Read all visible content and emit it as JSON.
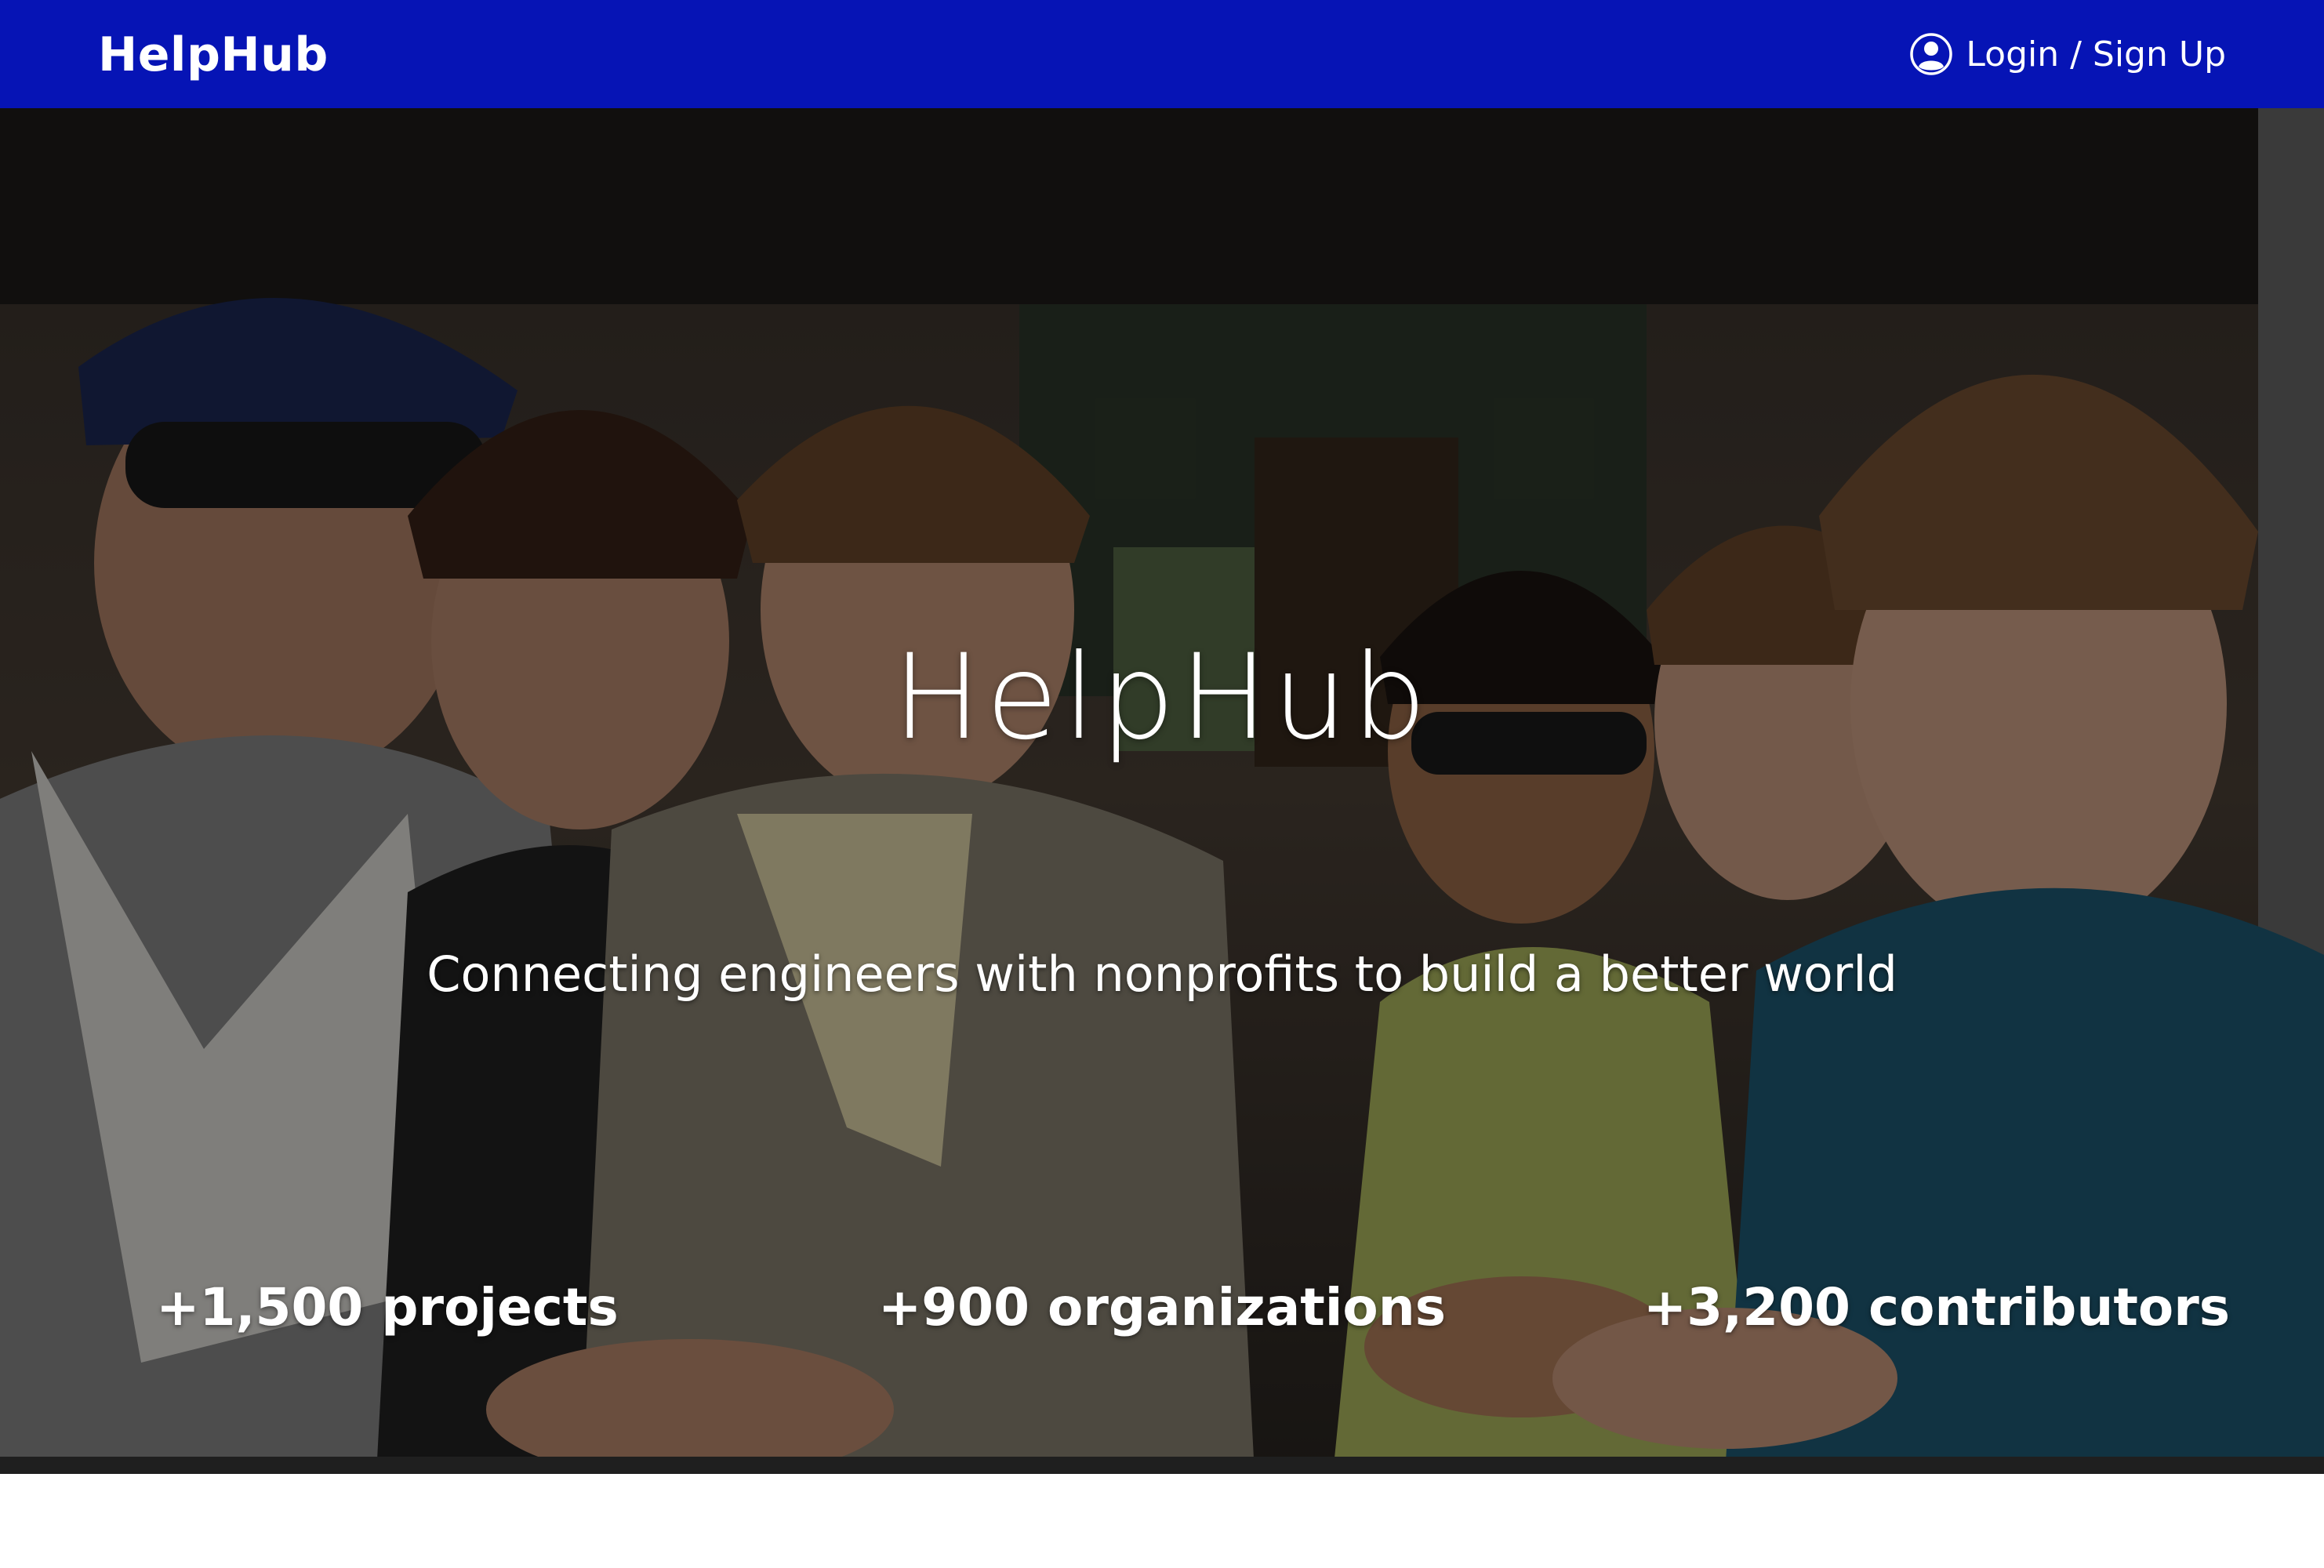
{
  "navbar": {
    "brand": "HelpHub",
    "login_label": "Login / Sign Up",
    "login_icon": "user-circle-icon",
    "background_color": "#0614b5"
  },
  "hero": {
    "title": "HelpHub",
    "subtitle": "Connecting engineers with nonprofits to build a better world",
    "stats": [
      "+1,500 projects",
      "+900 organizations",
      "+3,200 contributors"
    ]
  }
}
